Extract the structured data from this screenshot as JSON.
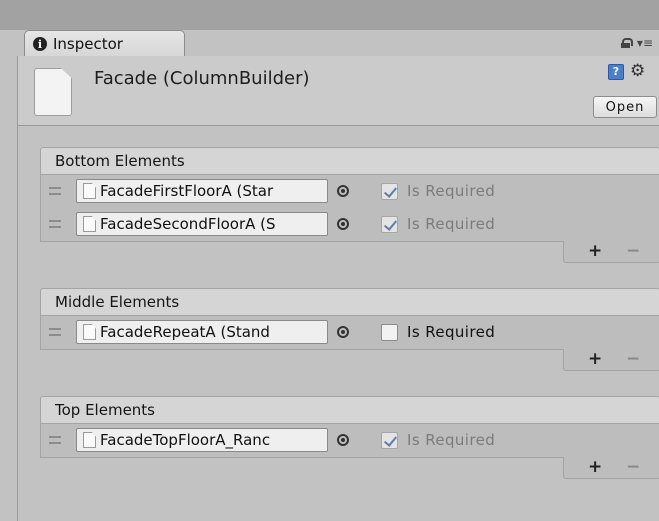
{
  "tab": {
    "title": "Inspector",
    "icon": "info-icon"
  },
  "window_controls": {
    "icons": [
      "lock-icon",
      "menu-icon"
    ],
    "menu_glyph": "▾≡"
  },
  "header": {
    "title": "Facade (ColumnBuilder)",
    "help_glyph": "?",
    "gear_glyph": "⚙",
    "open_label": "Open"
  },
  "groups": [
    {
      "title": "Bottom Elements",
      "rows": [
        {
          "object": "FacadeFirstFloorA (Star",
          "checked": true,
          "label": "Is Required"
        },
        {
          "object": "FacadeSecondFloorA (S",
          "checked": true,
          "label": "Is Required"
        }
      ]
    },
    {
      "title": "Middle Elements",
      "rows": [
        {
          "object": "FacadeRepeatA (Stand",
          "checked": false,
          "label": "Is Required"
        }
      ]
    },
    {
      "title": "Top Elements",
      "rows": [
        {
          "object": "FacadeTopFloorA_Ranc",
          "checked": true,
          "label": "Is Required"
        }
      ]
    }
  ],
  "footer": {
    "add_glyph": "+",
    "remove_glyph": "−"
  }
}
